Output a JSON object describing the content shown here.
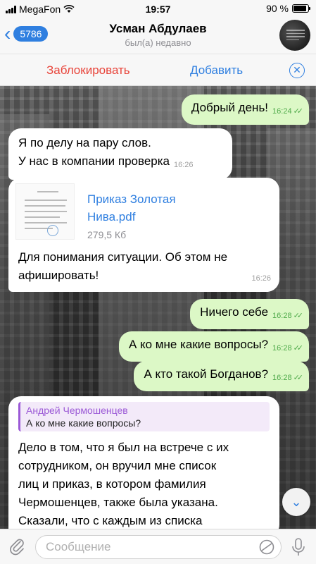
{
  "status": {
    "carrier": "MegaFon",
    "time": "19:57",
    "battery": "90 %",
    "battery_level": 0.9
  },
  "header": {
    "back_count": "5786",
    "title": "Усман Абдулаев",
    "subtitle": "был(а) недавно"
  },
  "actions": {
    "block": "Заблокировать",
    "add": "Добавить"
  },
  "messages": [
    {
      "type": "out",
      "text": "Добрый день!",
      "time": "16:24"
    },
    {
      "type": "in",
      "lines": [
        "Я по делу на пару слов.",
        "У нас в компании проверка"
      ],
      "time": "16:26"
    },
    {
      "type": "doc",
      "file_line1": "Приказ Золотая",
      "file_line2": "Нива.pdf",
      "size": "279,5 Кб",
      "lines": [
        "Для понимания ситуации. Об этом не",
        "афишировать!"
      ],
      "time": "16:26"
    },
    {
      "type": "out",
      "text": "Ничего себе",
      "time": "16:28"
    },
    {
      "type": "out",
      "text": "А ко мне какие вопросы?",
      "time": "16:28"
    },
    {
      "type": "out",
      "text": "А кто такой Богданов?",
      "time": "16:28"
    },
    {
      "type": "in-reply",
      "reply_name": "Андрей Чермошенцев",
      "reply_text": "А ко мне какие вопросы?",
      "lines": [
        "Дело в том, что я был на встрече с их",
        "сотрудником, он вручил мне список",
        "лиц и приказ, в котором фамилия",
        "Чермошенцев, также была указана.",
        "Сказали, что с каждым из списка"
      ]
    }
  ],
  "input": {
    "placeholder": "Сообщение"
  },
  "colors": {
    "accent": "#2f7fe0",
    "danger": "#e8443a",
    "outgoing": "#dcf8c6",
    "reply_accent": "#9b59d6"
  }
}
